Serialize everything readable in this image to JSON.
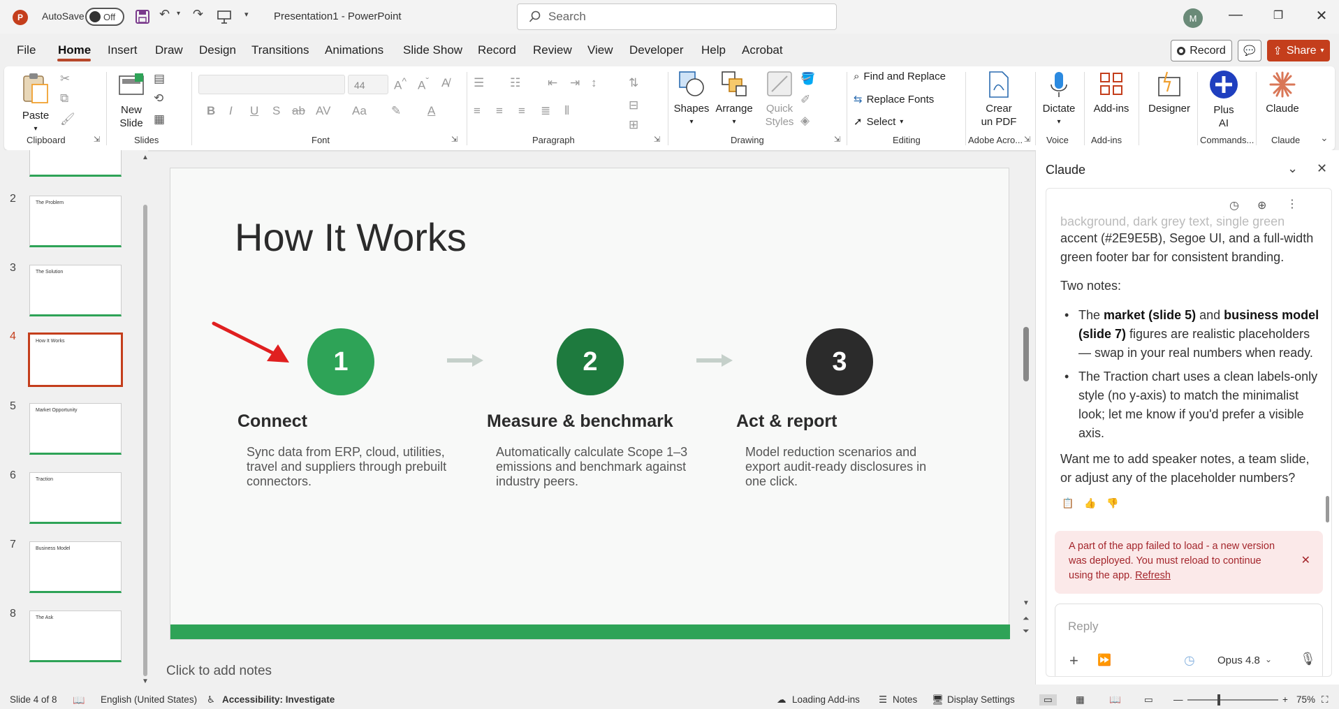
{
  "titlebar": {
    "autosave_label": "AutoSave",
    "autosave_state": "Off",
    "doc_title": "Presentation1 - PowerPoint",
    "search_placeholder": "Search",
    "avatar_initial": "M"
  },
  "tabs": [
    "File",
    "Home",
    "Insert",
    "Draw",
    "Design",
    "Transitions",
    "Animations",
    "Slide Show",
    "Record",
    "Review",
    "View",
    "Developer",
    "Help",
    "Acrobat"
  ],
  "active_tab": "Home",
  "actions": {
    "record": "Record",
    "share": "Share"
  },
  "ribbon": {
    "clipboard": {
      "paste": "Paste",
      "label": "Clipboard"
    },
    "slides": {
      "new_slide": "New Slide",
      "label": "Slides"
    },
    "font": {
      "size": "44",
      "label": "Font"
    },
    "paragraph": {
      "label": "Paragraph"
    },
    "drawing": {
      "shapes": "Shapes",
      "arrange": "Arrange",
      "quick_styles": "Quick Styles",
      "label": "Drawing"
    },
    "editing": {
      "find_replace": "Find and Replace",
      "replace_fonts": "Replace Fonts",
      "select": "Select",
      "label": "Editing"
    },
    "adobe": {
      "crear": "Crear un PDF",
      "label": "Adobe Acro..."
    },
    "voice": {
      "dictate": "Dictate",
      "label": "Voice"
    },
    "addins": {
      "addins": "Add-ins",
      "label": "Add-ins"
    },
    "designer": {
      "designer": "Designer"
    },
    "commands": {
      "plus_ai": "Plus AI",
      "label": "Commands..."
    },
    "claude": {
      "claude": "Claude",
      "label": "Claude"
    }
  },
  "thumbnails": [
    {
      "num": "2",
      "title": "The Problem"
    },
    {
      "num": "3",
      "title": "The Solution"
    },
    {
      "num": "4",
      "title": "How It Works"
    },
    {
      "num": "5",
      "title": "Market Opportunity"
    },
    {
      "num": "6",
      "title": "Traction"
    },
    {
      "num": "7",
      "title": "Business Model"
    },
    {
      "num": "8",
      "title": "The Ask"
    }
  ],
  "slide": {
    "title": "How It Works",
    "steps": [
      {
        "num": "1",
        "title": "Connect",
        "desc": "Sync data from ERP, cloud, utilities, travel and suppliers through prebuilt connectors.",
        "color": "#2ea357"
      },
      {
        "num": "2",
        "title": "Measure & benchmark",
        "desc": "Automatically calculate Scope 1–3 emissions and benchmark against industry peers.",
        "color": "#1e7a3e"
      },
      {
        "num": "3",
        "title": "Act & report",
        "desc": "Model reduction scenarios and export audit-ready disclosures in one click.",
        "color": "#2b2b2b"
      }
    ]
  },
  "notes_placeholder": "Click to add notes",
  "pane": {
    "title": "Claude",
    "msg_top_faded": "background, dark grey text, single green",
    "msg_top": "accent (#2E9E5B), Segoe UI, and a full-width green footer bar for consistent branding.",
    "two_notes": "Two notes:",
    "bullet1": {
      "pre": "The ",
      "b1": "market (slide 5)",
      "mid": " and ",
      "b2": "business model (slide 7)",
      "post": " figures are realistic placeholders — swap in your real numbers when ready."
    },
    "bullet2": "The Traction chart uses a clean labels-only style (no y-axis) to match the minimalist look; let me know if you'd prefer a visible axis.",
    "closing": "Want me to add speaker notes, a team slide, or adjust any of the placeholder numbers?",
    "error": "A part of the app failed to load - a new version was deployed. You must reload to continue using the app.",
    "error_link": "Refresh",
    "reply_placeholder": "Reply",
    "model": "Opus 4.8"
  },
  "status": {
    "slide_count": "Slide 4 of 8",
    "language": "English (United States)",
    "accessibility": "Accessibility: Investigate",
    "loading": "Loading Add-ins",
    "notes": "Notes",
    "display": "Display Settings",
    "zoom": "75%"
  },
  "colors": {
    "accent": "#c43e1c",
    "green": "#2ea357",
    "dark_green": "#1e7a3e"
  }
}
